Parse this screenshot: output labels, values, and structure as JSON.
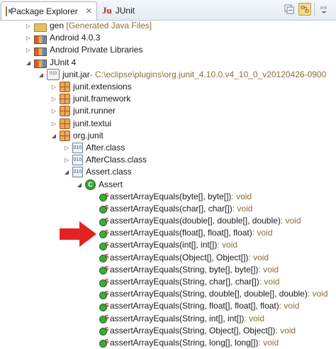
{
  "tabs": [
    {
      "label": "Package Explorer",
      "close": "✕",
      "icon": "package-explorer-icon",
      "active": true
    },
    {
      "label": "JUnit",
      "icon": "junit-icon",
      "active": false
    }
  ],
  "toolbar": {
    "buttons": [
      "collapse-all",
      "link-with-editor",
      "view-menu"
    ]
  },
  "tree": {
    "gen": {
      "name": "gen",
      "decoration": "[Generated Java Files]"
    },
    "android": {
      "name": "Android 4.0.3"
    },
    "android_private": {
      "name": "Android Private Libraries"
    },
    "junit4": {
      "name": "JUnit 4"
    },
    "jar": {
      "name": "junit.jar",
      "path": " - C:\\eclipse\\plugins\\org.junit_4.10.0.v4_10_0_v20120426-0900"
    },
    "packages": [
      "junit.extensions",
      "junit.framework",
      "junit.runner",
      "junit.textui",
      "org.junit"
    ],
    "classes": [
      "After.class",
      "AfterClass.class",
      "Assert.class"
    ],
    "type": "Assert",
    "methods": [
      {
        "sig": "assertArrayEquals(byte[], byte[])",
        "ret": " : void"
      },
      {
        "sig": "assertArrayEquals(char[], char[])",
        "ret": " : void"
      },
      {
        "sig": "assertArrayEquals(double[], double[], double)",
        "ret": " : void"
      },
      {
        "sig": "assertArrayEquals(float[], float[], float)",
        "ret": " : void"
      },
      {
        "sig": "assertArrayEquals(int[], int[])",
        "ret": " : void"
      },
      {
        "sig": "assertArrayEquals(Object[], Object[])",
        "ret": " : void"
      },
      {
        "sig": "assertArrayEquals(String, byte[], byte[])",
        "ret": " : void"
      },
      {
        "sig": "assertArrayEquals(String, char[], char[])",
        "ret": " : void"
      },
      {
        "sig": "assertArrayEquals(String, double[], double[], double)",
        "ret": " : void"
      },
      {
        "sig": "assertArrayEquals(String, float[], float[], float)",
        "ret": " : void"
      },
      {
        "sig": "assertArrayEquals(String, int[], int[])",
        "ret": " : void"
      },
      {
        "sig": "assertArrayEquals(String, Object[], Object[])",
        "ret": " : void"
      },
      {
        "sig": "assertArrayEquals(String, long[], long[])",
        "ret": " : void"
      }
    ]
  },
  "colors": {
    "arrow": "#e32321",
    "decoration": "#8b6f3a",
    "selection_tab": "#ffffff"
  }
}
